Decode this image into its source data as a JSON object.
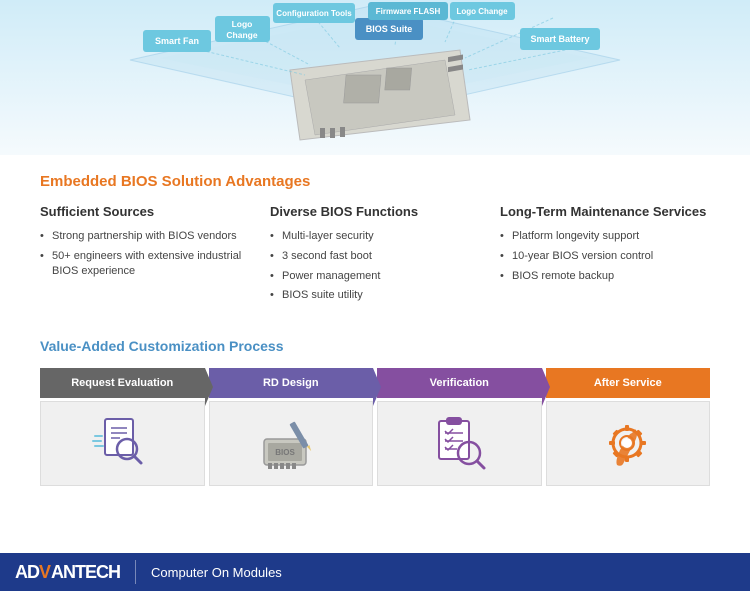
{
  "top": {
    "bubbles": [
      {
        "label": "Smart Fan",
        "id": "smart-fan"
      },
      {
        "label": "Logo\nChange",
        "id": "logo-change-left"
      },
      {
        "label": "Configuration Tools",
        "id": "config-tools"
      },
      {
        "label": "BIOS Suite",
        "id": "bios-suite"
      },
      {
        "label": "Firmware FLASH",
        "id": "firmware-flash"
      },
      {
        "label": "Logo Change",
        "id": "logo-change-right"
      },
      {
        "label": "Smart Battery",
        "id": "smart-battery"
      }
    ]
  },
  "section1": {
    "title": "Embedded BIOS Solution Advantages",
    "col1": {
      "title": "Sufficient Sources",
      "items": [
        "Strong partnership with BIOS vendors",
        "50+ engineers with extensive industrial BIOS experience"
      ]
    },
    "col2": {
      "title": "Diverse BIOS Functions",
      "items": [
        "Multi-layer security",
        "3 second fast boot",
        "Power management",
        "BIOS suite utility"
      ]
    },
    "col3": {
      "title": "Long-Term Maintenance Services",
      "items": [
        "Platform longevity support",
        "10-year BIOS version control",
        "BIOS remote backup"
      ]
    }
  },
  "section2": {
    "title": "Value-Added Customization Process",
    "steps": [
      {
        "label": "Request Evaluation",
        "id": "request-eval",
        "icon": "🔍📋"
      },
      {
        "label": "RD Design",
        "id": "rd-design",
        "icon": "💾"
      },
      {
        "label": "Verification",
        "id": "verification",
        "icon": "📋🔍"
      },
      {
        "label": "After Service",
        "id": "after-service",
        "icon": "🔧"
      }
    ]
  },
  "footer": {
    "brand_prefix": "AD",
    "brand_highlight": "V",
    "brand_suffix": "ANTECH",
    "tagline": "Computer On Modules"
  }
}
